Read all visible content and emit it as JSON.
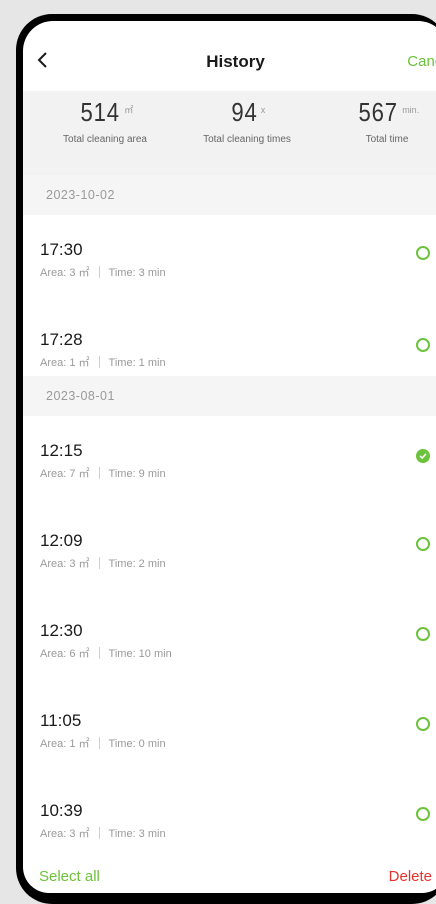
{
  "header": {
    "title": "History",
    "cancel_label": "Cancel"
  },
  "stats": [
    {
      "value": "514",
      "unit": "㎡",
      "label": "Total cleaning area"
    },
    {
      "value": "94",
      "unit": "x",
      "label": "Total cleaning times"
    },
    {
      "value": "567",
      "unit": "min.",
      "label": "Total time"
    }
  ],
  "groups": [
    {
      "date": "2023-10-02",
      "items": [
        {
          "time": "17:30",
          "area": "Area: 3 ㎡",
          "duration": "Time: 3 min",
          "selected": false
        },
        {
          "time": "17:28",
          "area": "Area: 1 ㎡",
          "duration": "Time: 1 min",
          "selected": false
        }
      ]
    },
    {
      "date": "2023-08-01",
      "items": [
        {
          "time": "12:15",
          "area": "Area: 7 ㎡",
          "duration": "Time: 9 min",
          "selected": true
        },
        {
          "time": "12:09",
          "area": "Area: 3 ㎡",
          "duration": "Time: 2 min",
          "selected": false
        },
        {
          "time": "12:30",
          "area": "Area: 6 ㎡",
          "duration": "Time: 10 min",
          "selected": false
        },
        {
          "time": "11:05",
          "area": "Area: 1 ㎡",
          "duration": "Time: 0 min",
          "selected": false
        },
        {
          "time": "10:39",
          "area": "Area: 3 ㎡",
          "duration": "Time: 3 min",
          "selected": false
        }
      ]
    }
  ],
  "footer": {
    "select_all_label": "Select all",
    "delete_label": "Delete"
  },
  "colors": {
    "accent": "#6cc23a",
    "danger": "#e5342c"
  }
}
